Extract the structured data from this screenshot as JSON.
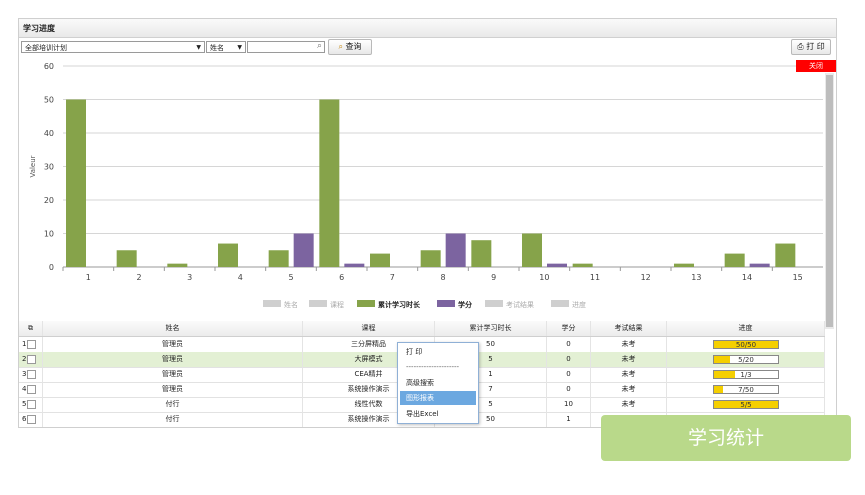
{
  "panel": {
    "title": "学习进度"
  },
  "toolbar": {
    "plan_select": "全部培训计划",
    "field_select": "姓名",
    "search_value": "",
    "search_button": "查询",
    "print_button": "打 印"
  },
  "chart_close": "关闭",
  "chart_data": {
    "type": "bar",
    "categories": [
      "1",
      "2",
      "3",
      "4",
      "5",
      "6",
      "7",
      "8",
      "9",
      "10",
      "11",
      "12",
      "13",
      "14",
      "15"
    ],
    "series": [
      {
        "name": "累计学习时长",
        "color": "#86a34a",
        "values": [
          50,
          5,
          1,
          7,
          5,
          50,
          4,
          5,
          8,
          10,
          1,
          0,
          1,
          4,
          7
        ]
      },
      {
        "name": "学分",
        "color": "#7c64a0",
        "values": [
          0,
          0,
          0,
          0,
          10,
          1,
          0,
          10,
          0,
          1,
          0,
          0,
          0,
          1,
          0
        ]
      }
    ],
    "ylabel": "Valeur",
    "xlabel": "",
    "ylim": [
      0,
      60
    ],
    "yticks": [
      0,
      10,
      20,
      30,
      40,
      50,
      60
    ],
    "legend": [
      {
        "label": "姓名",
        "active": false,
        "color": "#cfcfcf"
      },
      {
        "label": "课程",
        "active": false,
        "color": "#cfcfcf"
      },
      {
        "label": "累计学习时长",
        "active": true,
        "color": "#86a34a"
      },
      {
        "label": "学分",
        "active": true,
        "color": "#7c64a0"
      },
      {
        "label": "考试结果",
        "active": false,
        "color": "#cfcfcf"
      },
      {
        "label": "进度",
        "active": false,
        "color": "#cfcfcf"
      }
    ],
    "legend_placement": "bottom",
    "grid": true
  },
  "table": {
    "headers": [
      "姓名",
      "课程",
      "累计学习时长",
      "学分",
      "考试结果",
      "进度"
    ],
    "rows": [
      {
        "num": "1",
        "name": "管理员",
        "course": "三分屏精品",
        "hours": "50",
        "credit": "0",
        "exam": "未考",
        "progress_text": "50/50",
        "progress": 1.0
      },
      {
        "num": "2",
        "name": "管理员",
        "course": "大屏模式",
        "hours": "5",
        "credit": "0",
        "exam": "未考",
        "progress_text": "5/20",
        "progress": 0.25
      },
      {
        "num": "3",
        "name": "管理员",
        "course": "CEA精井",
        "hours": "1",
        "credit": "0",
        "exam": "未考",
        "progress_text": "1/3",
        "progress": 0.33
      },
      {
        "num": "4",
        "name": "管理员",
        "course": "系统操作演示",
        "hours": "7",
        "credit": "0",
        "exam": "未考",
        "progress_text": "7/50",
        "progress": 0.14
      },
      {
        "num": "5",
        "name": "付行",
        "course": "线性代数",
        "hours": "5",
        "credit": "10",
        "exam": "未考",
        "progress_text": "5/5",
        "progress": 1.0
      },
      {
        "num": "6",
        "name": "付行",
        "course": "系统操作演示",
        "hours": "50",
        "credit": "1",
        "exam": "未考",
        "progress_text": "",
        "progress": 1.0
      }
    ]
  },
  "context_menu": {
    "items": [
      "打 印",
      "---------------------",
      "高级搜索",
      "图形报表",
      "导出Excel"
    ],
    "highlighted": "图形报表"
  },
  "badge": {
    "label": "学习统计"
  }
}
